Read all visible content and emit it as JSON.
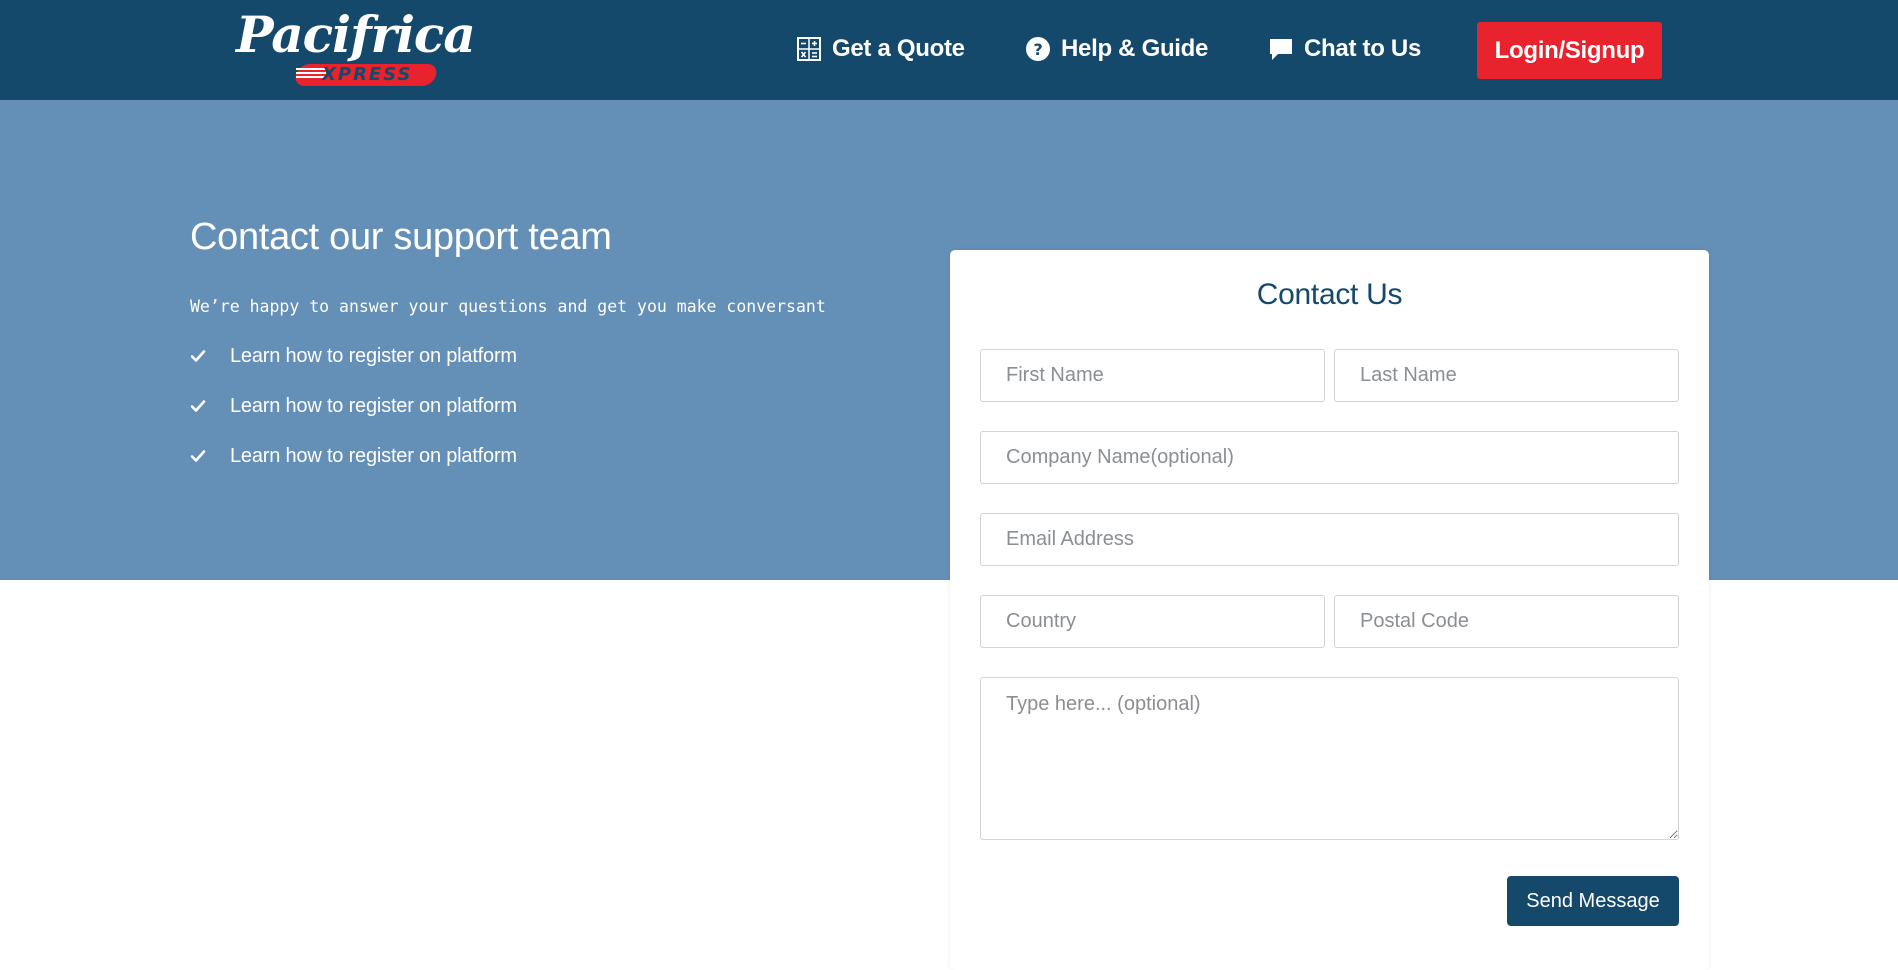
{
  "brand": {
    "logo_text": "Pacifrica",
    "logo_subtext": "XPRESS"
  },
  "nav": {
    "quote_label": "Get a Quote",
    "help_label": "Help & Guide",
    "chat_label": "Chat to Us",
    "login_label": "Login/Signup"
  },
  "hero": {
    "title": "Contact our support team",
    "subtitle": "We’re happy to answer your questions and get you make conversant",
    "features": [
      "Learn how to register on platform",
      "Learn how to register on platform",
      "Learn how to register on platform"
    ]
  },
  "form": {
    "title": "Contact Us",
    "first_name_placeholder": "First Name",
    "last_name_placeholder": "Last Name",
    "company_placeholder": "Company Name(optional)",
    "email_placeholder": "Email Address",
    "country_placeholder": "Country",
    "postal_placeholder": "Postal Code",
    "message_placeholder": "Type here... (optional)",
    "submit_label": "Send Message"
  },
  "colors": {
    "navbar": "#15496b",
    "hero": "#648fb7",
    "accent_red": "#e8232d",
    "primary_dark": "#15496b"
  }
}
